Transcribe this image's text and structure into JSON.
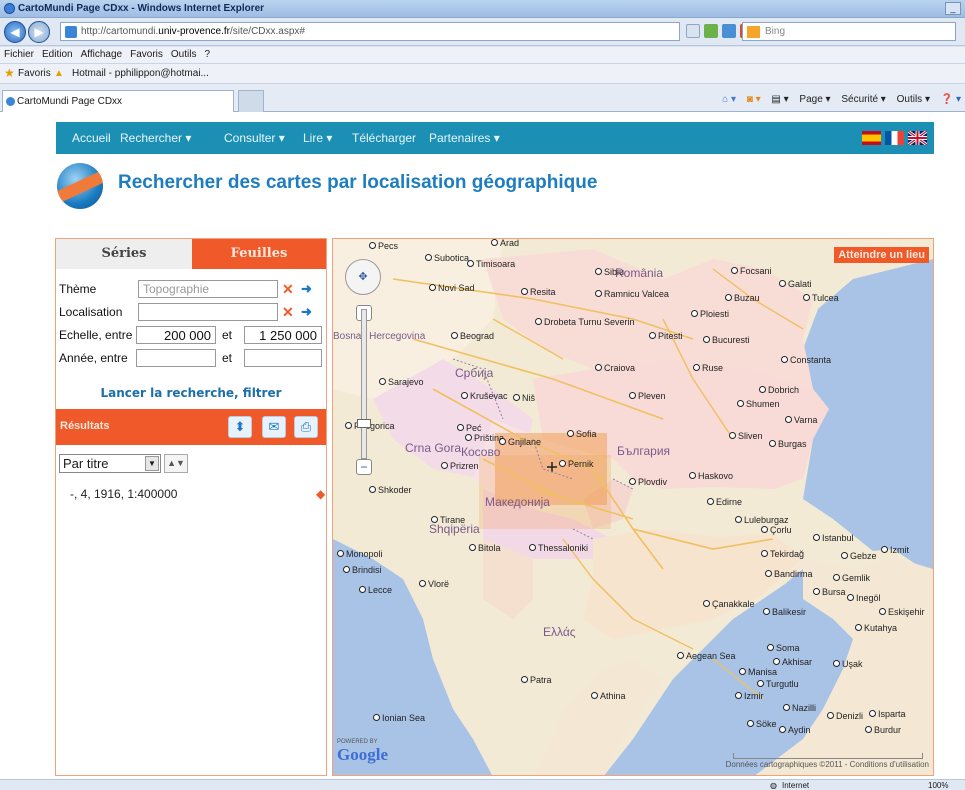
{
  "window": {
    "title": "CartoMundi Page CDxx - Windows Internet Explorer"
  },
  "address": {
    "url_prefix": "http://cartomundi.",
    "url_host": "univ-provence.fr",
    "url_rest": "/site/CDxx.aspx#",
    "search_placeholder": "Bing"
  },
  "menu": [
    "Fichier",
    "Edition",
    "Affichage",
    "Favoris",
    "Outils",
    "?"
  ],
  "favorites": {
    "label": "Favoris",
    "hotmail": "Hotmail - pphilippon@hotmai..."
  },
  "tab": {
    "title": "CartoMundi Page CDxx"
  },
  "commandbar": {
    "page": "Page ▾",
    "securite": "Sécurité ▾",
    "outils": "Outils ▾"
  },
  "nav": {
    "items": [
      "Accueil",
      "Rechercher ▾",
      "Consulter ▾",
      "Lire ▾",
      "Télécharger",
      "Partenaires ▾"
    ]
  },
  "page": {
    "title": "Rechercher des cartes par localisation géographique"
  },
  "panel": {
    "tabs": {
      "series": "Séries",
      "feuilles": "Feuilles"
    },
    "theme_label": "Thème",
    "theme_value": "Topographie",
    "localisation_label": "Localisation",
    "localisation_value": "",
    "echelle_label": "Echelle, entre",
    "echelle_min": "200 000",
    "et1": "et",
    "echelle_max": "1 250 000",
    "annee_label": "Année, entre",
    "annee_min": "",
    "et2": "et",
    "annee_max": "",
    "search_button": "Lancer la recherche, filtrer",
    "results_label": "Résultats",
    "sort_value": "Par titre",
    "results": [
      "-, 4, 1916, 1:400000"
    ]
  },
  "map": {
    "goto_button": "Atteindre un lieu",
    "countries": [
      "România",
      "Србија",
      "Crna Gora",
      "Косово",
      "Македонија",
      "Shqipëria",
      "Ελλάς",
      "България",
      "Bosna i Hercegovina"
    ],
    "cities": [
      "Pecs",
      "Arad",
      "Subotica",
      "Timisoara",
      "Sibiu",
      "Focsani",
      "Galati",
      "Novi Sad",
      "Resita",
      "Ramnicu Valcea",
      "Buzau",
      "Tulcea",
      "Drobeta Turnu Severin",
      "Ploiesti",
      "Beograd",
      "Pitesti",
      "Bucuresti",
      "Craiova",
      "Constanta",
      "Sarajevo",
      "Ruse",
      "Dobrich",
      "Kruševac",
      "Niš",
      "Pleven",
      "Shumen",
      "Varna",
      "Peć",
      "Priština",
      "Gnjilane",
      "Sofia",
      "Sliven",
      "Burgas",
      "Podgorica",
      "Prizren",
      "Pernik",
      "Plovdiv",
      "Haskovo",
      "Shkoder",
      "Edirne",
      "Tirane",
      "Luleburgaz",
      "Çorlu",
      "Istanbul",
      "Izmit",
      "Bitola",
      "Thessaloniki",
      "Tekirdağ",
      "Gebze",
      "Monopoli",
      "Brindisi",
      "Bandirma",
      "Gemlik",
      "Vlorë",
      "Bursa",
      "Inegöl",
      "Lecce",
      "Çanakkale",
      "Balikesir",
      "Eskişehir",
      "Kutahya",
      "Soma",
      "Akhisar",
      "Uşak",
      "Manisa",
      "Turgutlu",
      "Izmir",
      "Nazilli",
      "Denizli",
      "Isparta",
      "Söke",
      "Aydin",
      "Burdur",
      "Patra",
      "Athina",
      "Ionian Sea",
      "Aegean Sea"
    ],
    "copyright": "Données cartographiques ©2011 - Conditions d'utilisation"
  },
  "status": {
    "zone": "Internet",
    "zoom": "100%"
  }
}
